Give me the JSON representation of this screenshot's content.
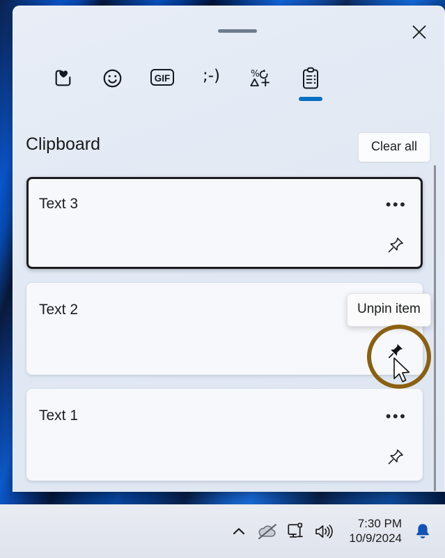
{
  "window": {
    "title": "Clipboard",
    "grip": "drag-handle",
    "close_label": "Close"
  },
  "tabs": [
    {
      "id": "recent",
      "icon": "heart-square-icon",
      "glyph": "",
      "label": "Most recently used"
    },
    {
      "id": "emoji",
      "icon": "smiley-face-icon",
      "glyph": "",
      "label": "Emoji"
    },
    {
      "id": "gif",
      "icon": "gif-icon",
      "glyph": "GIF",
      "label": "GIF"
    },
    {
      "id": "kaomoji",
      "icon": "kaomoji-icon",
      "glyph": ";-)",
      "label": "Kaomoji"
    },
    {
      "id": "symbols",
      "icon": "symbols-icon",
      "glyph": "% ↻ △ +",
      "label": "Symbols"
    },
    {
      "id": "clipboard",
      "icon": "clipboard-icon",
      "glyph": "",
      "label": "Clipboard",
      "active": true
    }
  ],
  "header": {
    "title": "Clipboard",
    "clear_all_label": "Clear all"
  },
  "clipboard_items": [
    {
      "text": "Text 3",
      "pinned": false,
      "focused": true,
      "menu_label": "See more",
      "pin_label": "Pin item"
    },
    {
      "text": "Text 2",
      "pinned": true,
      "focused": false,
      "menu_label": "See more",
      "pin_label": "Unpin item",
      "hide_menu": true
    },
    {
      "text": "Text 1",
      "pinned": false,
      "focused": false,
      "menu_label": "See more",
      "pin_label": "Pin item"
    }
  ],
  "tooltip": {
    "text": "Unpin item"
  },
  "annotation": {
    "shape": "circle",
    "color": "#8a6010",
    "target": "unpin-pin-button"
  },
  "taskbar": {
    "items": [
      {
        "id": "show-hidden",
        "icon": "chevron-up-icon",
        "label": "Show hidden icons"
      },
      {
        "id": "onedrive",
        "icon": "cloud-offline-icon",
        "label": "OneDrive - not signed in"
      },
      {
        "id": "network",
        "icon": "monitor-network-icon",
        "label": "Network"
      },
      {
        "id": "volume",
        "icon": "speaker-icon",
        "label": "Volume"
      }
    ],
    "time": "7:30 PM",
    "date": "10/9/2024",
    "notification": {
      "icon": "bell-icon",
      "label": "Notifications",
      "color": "#1351b4"
    }
  },
  "colors": {
    "panel_bg": "#e4eaf4",
    "card_bg": "#f7f8fb",
    "accent": "#0a6fc2",
    "focus_border": "#1b1b1f",
    "annotation": "#8a6010"
  }
}
